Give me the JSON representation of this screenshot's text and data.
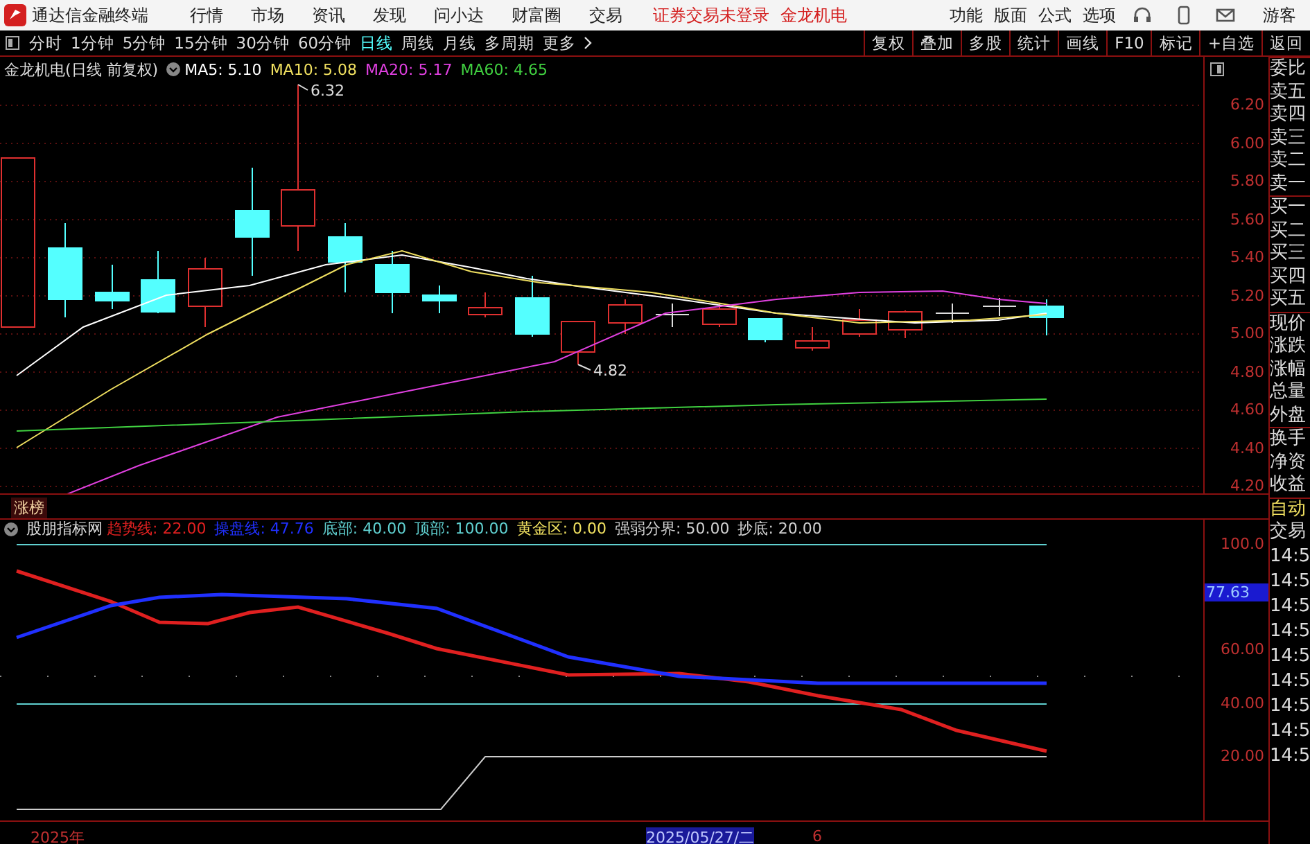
{
  "app_bar": {
    "title": "通达信金融终端",
    "menu": [
      "行情",
      "市场",
      "资讯",
      "发现",
      "问小达",
      "财富圈",
      "交易"
    ],
    "notice": "证券交易未登录",
    "stock": "金龙机电",
    "right_menu": [
      "功能",
      "版面",
      "公式",
      "选项"
    ],
    "user": "游客"
  },
  "period_bar": {
    "periods": [
      {
        "label": "分时",
        "selected": false
      },
      {
        "label": "1分钟",
        "selected": false
      },
      {
        "label": "5分钟",
        "selected": false
      },
      {
        "label": "15分钟",
        "selected": false
      },
      {
        "label": "30分钟",
        "selected": false
      },
      {
        "label": "60分钟",
        "selected": false
      },
      {
        "label": "日线",
        "selected": true
      },
      {
        "label": "周线",
        "selected": false
      },
      {
        "label": "月线",
        "selected": false
      },
      {
        "label": "多周期",
        "selected": false
      },
      {
        "label": "更多",
        "selected": false
      }
    ],
    "tools": [
      "复权",
      "叠加",
      "多股",
      "统计",
      "画线",
      "F10",
      "标记",
      "+自选",
      "返回"
    ]
  },
  "main_chart": {
    "title": "金龙机电(日线 前复权)",
    "ma": [
      {
        "text": "MA5: 5.10",
        "color": "#ffffff"
      },
      {
        "text": "MA10: 5.08",
        "color": "#f0e060"
      },
      {
        "text": "MA20: 5.17",
        "color": "#e040e0"
      },
      {
        "text": "MA60: 4.65",
        "color": "#40d040"
      }
    ],
    "y_labels": [
      "6.20",
      "6.00",
      "5.80",
      "5.60",
      "5.40",
      "5.20",
      "5.00",
      "4.80",
      "4.60",
      "4.40",
      "4.20"
    ],
    "high_label": "6.32",
    "low_label": "4.82"
  },
  "tag": "涨榜",
  "indicator": {
    "name": "股朋指标网",
    "params": [
      {
        "text": "趋势线: 22.00",
        "color": "#e02020"
      },
      {
        "text": "操盘线: 47.76",
        "color": "#2030ff"
      },
      {
        "text": "底部: 40.00",
        "color": "#60d0d0"
      },
      {
        "text": "顶部: 100.00",
        "color": "#60d0d0"
      },
      {
        "text": "黄金区: 0.00",
        "color": "#f0e060"
      },
      {
        "text": "强弱分界: 50.00",
        "color": "#d0d0d0"
      },
      {
        "text": "抄底: 20.00",
        "color": "#d0d0d0"
      }
    ],
    "y_labels": [
      "100.0",
      "60.00",
      "40.00",
      "20.00"
    ],
    "current": "77.63"
  },
  "side_panel": {
    "quote_labels": [
      "委比",
      "卖五",
      "卖四",
      "卖三",
      "卖二",
      "卖一",
      "买一",
      "买二",
      "买三",
      "买四",
      "买五",
      "现价",
      "涨跌",
      "涨幅",
      "总量",
      "外盘",
      "换手",
      "净资",
      "收益"
    ],
    "trade_labels": [
      "自动",
      "交易"
    ],
    "times": [
      "14:5",
      "14:5",
      "14:5",
      "14:5",
      "14:5",
      "14:5",
      "14:5",
      "14:5",
      "14:5"
    ]
  },
  "time_axis": [
    {
      "text": "2025年",
      "selected": false
    },
    {
      "text": "2025/05/27/二",
      "selected": true
    },
    {
      "text": "6",
      "selected": false
    }
  ]
}
